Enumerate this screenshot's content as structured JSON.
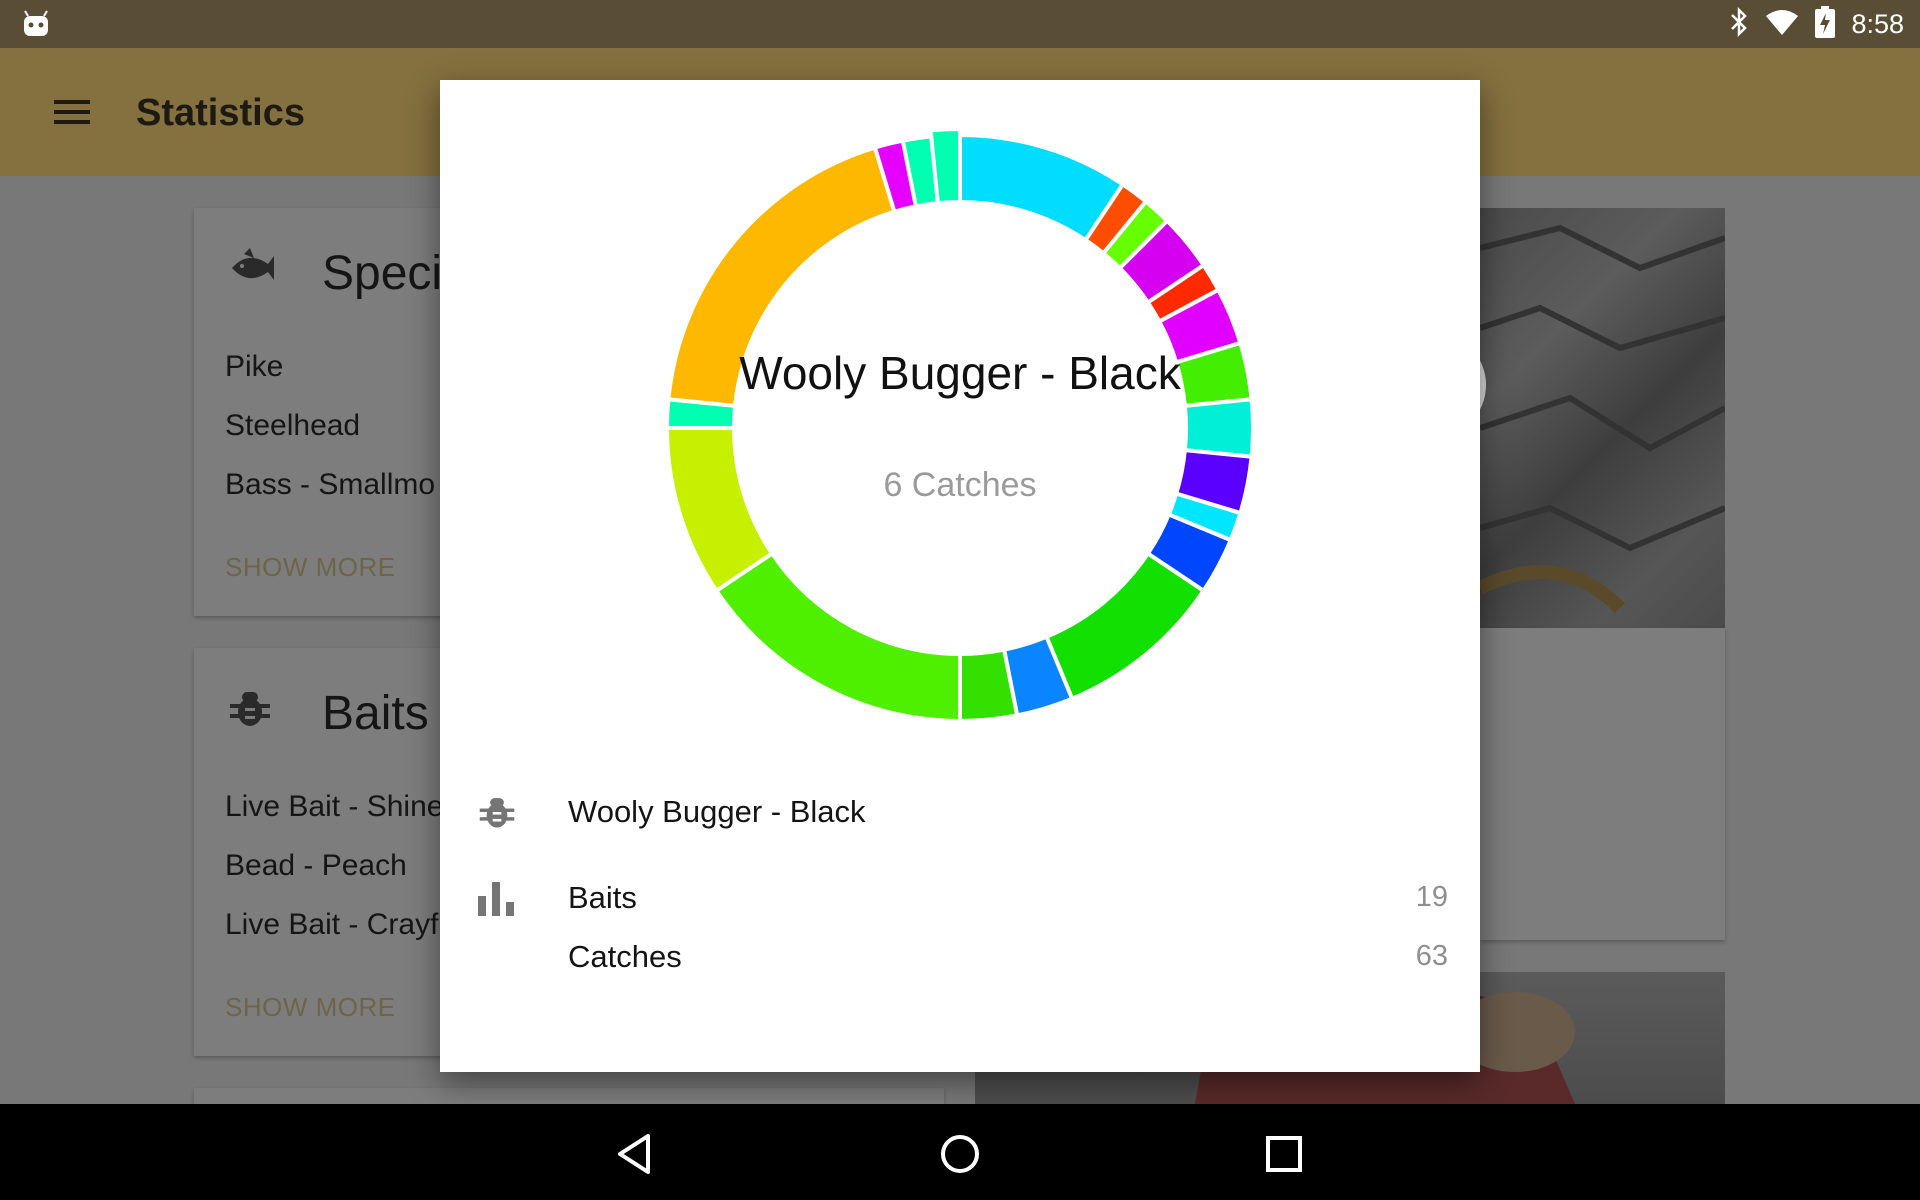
{
  "status_bar": {
    "time": "8:58",
    "icons": [
      "android-icon",
      "bluetooth-icon",
      "wifi-icon",
      "battery-charging-icon"
    ]
  },
  "toolbar": {
    "title": "Statistics",
    "menu_icon": "hamburger-menu-icon"
  },
  "background": {
    "species_card": {
      "title": "Speci",
      "icon": "fish-icon",
      "items": [
        "Pike",
        "Steelhead",
        "Bass - Smallmo"
      ],
      "show_more": "SHOW MORE"
    },
    "baits_card": {
      "title": "Baits",
      "icon": "bug-icon",
      "items": [
        "Live Bait - Shine",
        "Bead - Peach",
        "Live Bait - Crayf"
      ],
      "show_more": "SHOW MORE"
    }
  },
  "dialog": {
    "selected_title": "Wooly Bugger - Black",
    "selected_subtitle": "6 Catches",
    "selected_row_label": "Wooly Bugger - Black",
    "stats": [
      {
        "label": "Baits",
        "value": "19"
      },
      {
        "label": "Catches",
        "value": "63"
      }
    ]
  },
  "fab": {
    "icon": "ladybug-icon"
  },
  "nav_bar": {
    "icons": [
      "back-icon",
      "home-icon",
      "recents-icon"
    ]
  },
  "chart_data": {
    "type": "pie",
    "values": [
      6,
      1,
      1,
      2,
      1,
      2,
      2,
      2,
      2,
      1,
      2,
      6,
      2,
      2,
      10,
      6,
      1,
      12,
      1,
      1,
      1
    ],
    "colors": [
      "#00ddff",
      "#ff4d00",
      "#66ff00",
      "#d400ef",
      "#ff2a00",
      "#e100ff",
      "#44ee00",
      "#00efd6",
      "#5a00ff",
      "#00e6ff",
      "#0046ff",
      "#11e000",
      "#0a84ff",
      "#33e000",
      "#4ef000",
      "#c6f000",
      "#00ffb0",
      "#ffb800",
      "#e600ff",
      "#00ffb0",
      "#00ffb0"
    ],
    "total": 63,
    "selected_value": 6
  }
}
